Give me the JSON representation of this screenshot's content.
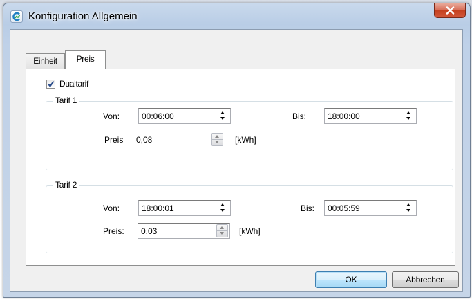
{
  "window": {
    "title": "Konfiguration Allgemein",
    "icon": "app-logo-icon",
    "close_icon": "close-icon"
  },
  "tabs": [
    {
      "label": "Einheit",
      "active": false
    },
    {
      "label": "Preis",
      "active": true
    }
  ],
  "dualtarif": {
    "label": "Dualtarif",
    "checked": true
  },
  "tarif1": {
    "legend": "Tarif 1",
    "von_label": "Von:",
    "von_value": "00:06:00",
    "bis_label": "Bis:",
    "bis_value": "18:00:00",
    "preis_label": "Preis",
    "preis_value": "0,08",
    "unit": "[kWh]"
  },
  "tarif2": {
    "legend": "Tarif 2",
    "von_label": "Von:",
    "von_value": "18:00:01",
    "bis_label": "Bis:",
    "bis_value": "00:05:59",
    "preis_label": "Preis:",
    "preis_value": "0,03",
    "unit": "[kWh]"
  },
  "buttons": {
    "ok": "OK",
    "cancel": "Abbrechen"
  },
  "colors": {
    "close_button": "#c4401f",
    "ok_border": "#3c7fb1",
    "checkmark": "#2b4d8c"
  }
}
